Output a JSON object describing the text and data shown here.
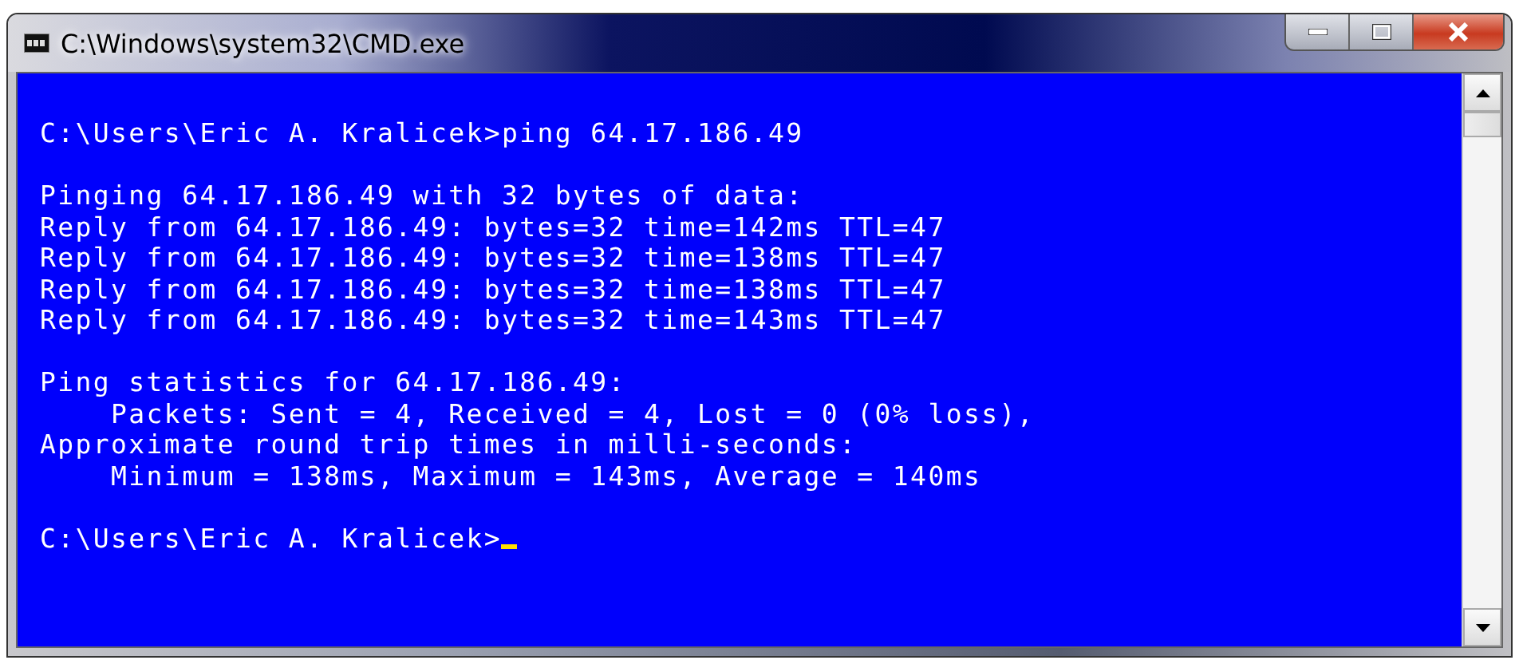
{
  "window": {
    "title": "C:\\Windows\\system32\\CMD.exe"
  },
  "console": {
    "blocks": [
      [
        "C:\\Users\\Eric A. Kralicek>ping 64.17.186.49"
      ],
      [
        "Pinging 64.17.186.49 with 32 bytes of data:",
        "Reply from 64.17.186.49: bytes=32 time=142ms TTL=47",
        "Reply from 64.17.186.49: bytes=32 time=138ms TTL=47",
        "Reply from 64.17.186.49: bytes=32 time=138ms TTL=47",
        "Reply from 64.17.186.49: bytes=32 time=143ms TTL=47"
      ],
      [
        "Ping statistics for 64.17.186.49:",
        "    Packets: Sent = 4, Received = 4, Lost = 0 (0% loss),",
        "Approximate round trip times in milli-seconds:",
        "    Minimum = 138ms, Maximum = 143ms, Average = 140ms"
      ]
    ],
    "prompt": "C:\\Users\\Eric A. Kralicek>"
  }
}
